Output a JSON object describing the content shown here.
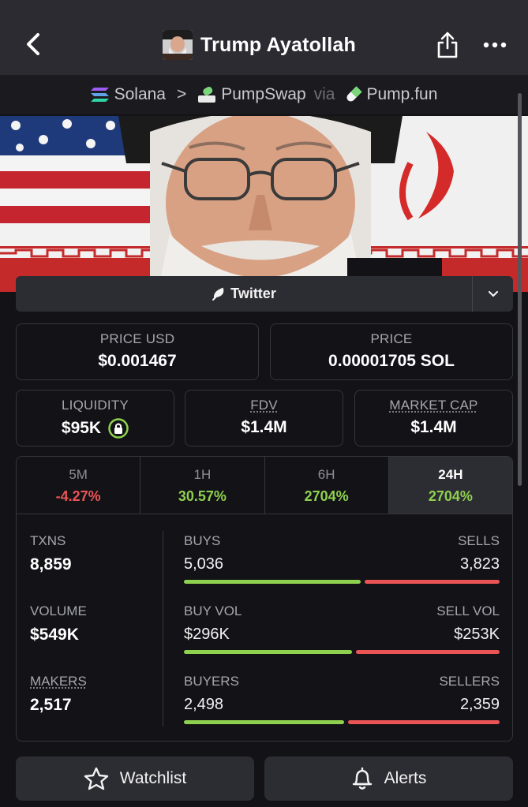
{
  "header": {
    "title": "Trump Ayatollah",
    "back_icon": "chevron-left-icon",
    "share_icon": "share-icon",
    "more_icon": "more-horizontal-icon"
  },
  "breadcrumb": {
    "chain": "Solana",
    "separator": ">",
    "dex": "PumpSwap",
    "via": "via",
    "launchpad": "Pump.fun"
  },
  "twitter": {
    "label": "Twitter"
  },
  "price_usd": {
    "label": "PRICE USD",
    "value": "$0.001467"
  },
  "price_native": {
    "label": "PRICE",
    "value": "0.00001705 SOL"
  },
  "liquidity": {
    "label": "LIQUIDITY",
    "value": "$95K"
  },
  "fdv": {
    "label": "FDV",
    "value": "$1.4M"
  },
  "market_cap": {
    "label": "MARKET CAP",
    "value": "$1.4M"
  },
  "timeframes": [
    {
      "label": "5M",
      "value": "-4.27%",
      "color": "#ea5455"
    },
    {
      "label": "1H",
      "value": "30.57%",
      "color": "#8fd14f"
    },
    {
      "label": "6H",
      "value": "2704%",
      "color": "#8fd14f"
    },
    {
      "label": "24H",
      "value": "2704%",
      "color": "#8fd14f",
      "active": true
    }
  ],
  "stats": {
    "txns": {
      "label": "TXNS",
      "value": "8,859"
    },
    "buys": {
      "label": "BUYS",
      "value": "5,036",
      "fraction": 0.568
    },
    "sells": {
      "label": "SELLS",
      "value": "3,823"
    },
    "volume": {
      "label": "VOLUME",
      "value": "$549K"
    },
    "buy_vol": {
      "label": "BUY VOL",
      "value": "$296K",
      "fraction": 0.539
    },
    "sell_vol": {
      "label": "SELL VOL",
      "value": "$253K"
    },
    "makers": {
      "label": "MAKERS",
      "value": "2,517"
    },
    "buyers": {
      "label": "BUYERS",
      "value": "2,498",
      "fraction": 0.514
    },
    "sellers": {
      "label": "SELLERS",
      "value": "2,359"
    }
  },
  "actions": {
    "watchlist": "Watchlist",
    "alerts": "Alerts"
  },
  "colors": {
    "positive": "#8fd14f",
    "negative": "#ea5455",
    "lock_badge": "#8fd14f"
  }
}
